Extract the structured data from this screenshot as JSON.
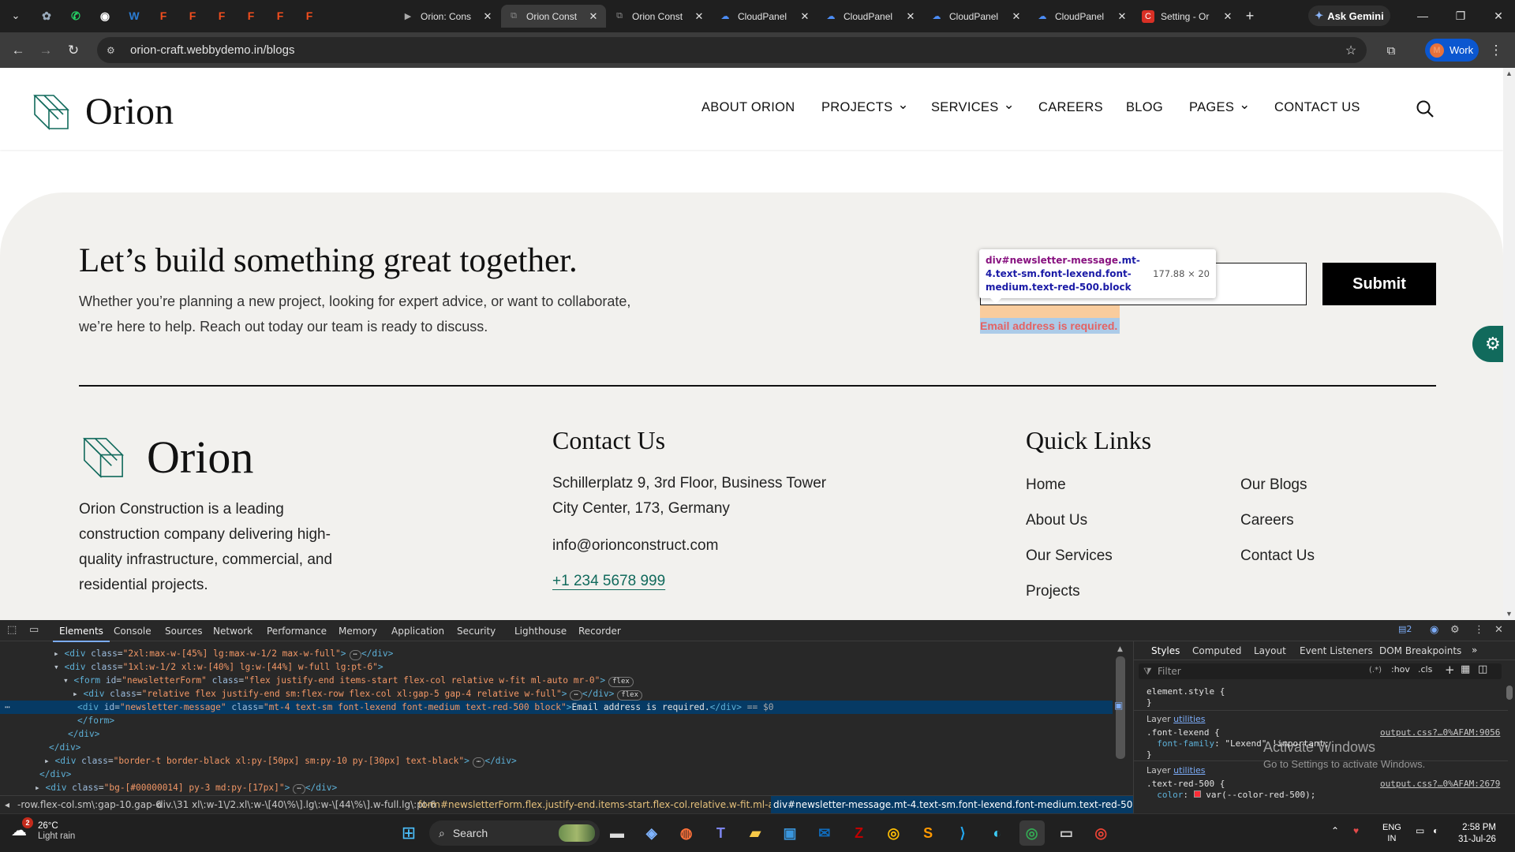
{
  "browser": {
    "tabs": [
      {
        "title": "Orion: Cons",
        "active": false
      },
      {
        "title": "Orion Const",
        "active": true
      },
      {
        "title": "Orion Const",
        "active": false
      },
      {
        "title": "CloudPanel",
        "active": false
      },
      {
        "title": "CloudPanel",
        "active": false
      },
      {
        "title": "CloudPanel",
        "active": false
      },
      {
        "title": "CloudPanel",
        "active": false
      },
      {
        "title": "Setting - Or",
        "active": false
      }
    ],
    "pinned_icons": [
      "pin-app-icon",
      "whatsapp-icon",
      "github-icon",
      "word-icon",
      "figma-icon",
      "figma-icon",
      "figma-icon",
      "figma-icon",
      "figma-icon",
      "figma-icon"
    ],
    "gemini_label": "Ask Gemini",
    "url": "orion-craft.webbydemo.in/blogs",
    "profile_label": "Work",
    "profile_initial": "M"
  },
  "site": {
    "brand": "Orion",
    "nav": [
      {
        "label": "ABOUT ORION",
        "dropdown": false
      },
      {
        "label": "PROJECTS",
        "dropdown": true
      },
      {
        "label": "SERVICES",
        "dropdown": true
      },
      {
        "label": "CAREERS",
        "dropdown": false
      },
      {
        "label": "BLOG",
        "dropdown": false
      },
      {
        "label": "PAGES",
        "dropdown": true
      },
      {
        "label": "CONTACT US",
        "dropdown": false
      }
    ],
    "cta": {
      "heading": "Let’s build something great together.",
      "line1": "Whether you’re planning a new project, looking for expert advice, or want to collaborate,",
      "line2": "we’re here to help. Reach out today our team is ready to discuss.",
      "submit_label": "Submit",
      "error_message": "Email address is required."
    },
    "inspect_tooltip": {
      "selector_tag": "div#newsletter-message",
      "selector_classes": ".mt-4.text-sm.font-lexend.font-medium.text-red-500.block",
      "dimensions": "177.88 × 20"
    },
    "footer": {
      "about_lines": [
        "Orion Construction is a leading",
        "construction company delivering high-",
        "quality infrastructure, commercial, and",
        "residential projects."
      ],
      "contact_heading": "Contact Us",
      "address_line1": "Schillerplatz 9, 3rd Floor, Business Tower",
      "address_line2": "City Center, 173, Germany",
      "email": "info@orionconstruct.com",
      "phone": "+1 234 5678 999",
      "quick_heading": "Quick Links",
      "links_col1": [
        "Home",
        "About Us",
        "Our Services",
        "Projects"
      ],
      "links_col2": [
        "Our Blogs",
        "Careers",
        "Contact Us"
      ]
    },
    "accent_color": "#116a5c"
  },
  "devtools": {
    "tabs": [
      "Elements",
      "Console",
      "Sources",
      "Network",
      "Performance",
      "Memory",
      "Application",
      "Security",
      "Lighthouse",
      "Recorder"
    ],
    "issues_count": "2",
    "dom_lines": [
      "<div class=\"2xl:max-w-[45%] lg:max-w-1/2 max-w-full\">⋯</div>",
      "<div class=\"1xl:w-1/2 xl:w-[40%] lg:w-[44%] w-full lg:pt-6\">",
      "<form id=\"newsletterForm\" class=\"flex justify-end items-start flex-col relative w-fit ml-auto mr-0\">",
      "<div class=\"relative flex justify-end sm:flex-row flex-col xl:gap-5 gap-4 relative w-full\">⋯</div>",
      "<div id=\"newsletter-message\" class=\"mt-4 text-sm font-lexend font-medium text-red-500 block\">Email address is required.</div> == $0",
      "</form>",
      "</div>",
      "</div>",
      "<div class=\"border-t border-black xl:py-[50px] sm:py-10 py-[30px] text-black\">⋯</div>",
      "</div>",
      "<div class=\"bg-[#00000014] py-3 md:py-[17px]\">⋯</div>"
    ],
    "flex_badge": "flex",
    "breadcrumbs": [
      "-row.flex-col.sm\\:gap-10.gap-6",
      "div.\\31 xl\\:w-1\\/2.xl\\:w-\\[40\\%\\].lg\\:w-\\[44\\%\\].w-full.lg\\:pt-6",
      "form#newsletterForm.flex.justify-end.items-start.flex-col.relative.w-fit.ml-auto.mr-0",
      "div#newsletter-message.mt-4.text-sm.font-lexend.font-medium.text-red-500.block"
    ],
    "styles_tabs": [
      "Styles",
      "Computed",
      "Layout",
      "Event Listeners",
      "DOM Breakpoints"
    ],
    "filter_placeholder": "Filter",
    "filter_tools": [
      ":hov",
      ".cls"
    ],
    "element_style": "element.style {\n}",
    "layer_label": "Layer",
    "layer_link": "utilities",
    "rule1_selector": ".font-lexend {",
    "rule1_prop": "font-family",
    "rule1_value": "\"Lexend\" !important;",
    "rule1_source": "output.css?…0%AFAM:9056",
    "rule2_selector": ".text-red-500 {",
    "rule2_prop": "color",
    "rule2_value": "var(--color-red-500);",
    "rule2_source": "output.css?…0%AFAM:2679",
    "watermark_title": "Activate Windows",
    "watermark_sub": "Go to Settings to activate Windows."
  },
  "taskbar": {
    "temperature": "26°C",
    "weather": "Light rain",
    "weather_badge": "2",
    "search_label": "Search",
    "lang1": "ENG",
    "lang2": "IN",
    "time": "2:58 PM",
    "date": "31-Jul-26"
  }
}
